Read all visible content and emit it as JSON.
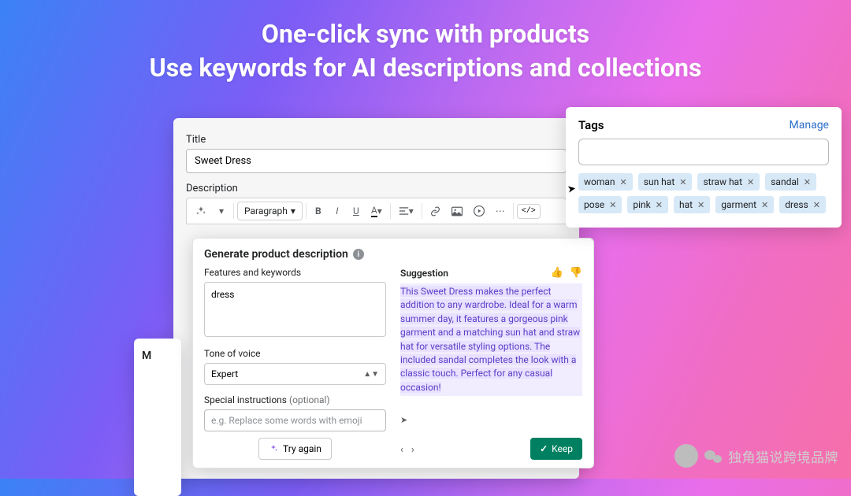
{
  "headline": {
    "line1": "One-click sync with products",
    "line2": "Use keywords for AI descriptions and collections"
  },
  "editor": {
    "title_label": "Title",
    "title_value": "Sweet Dress",
    "desc_label": "Description",
    "para_label": "Paragraph"
  },
  "popover": {
    "heading": "Generate product description",
    "features_label": "Features and keywords",
    "features_value": "dress",
    "tone_label": "Tone of voice",
    "tone_value": "Expert",
    "special_label": "Special instructions",
    "special_optional": "(optional)",
    "special_placeholder": "e.g. Replace some words with emoji",
    "try_again": "Try again",
    "suggestion_label": "Suggestion",
    "suggestion_text": "This Sweet Dress makes the perfect addition to any wardrobe. Ideal for a warm summer day, it features a gorgeous pink garment and a matching sun hat and straw hat for versatile styling options. The included sandal completes the look with a classic touch. Perfect for any casual occasion!",
    "keep": "Keep"
  },
  "tags_panel": {
    "title": "Tags",
    "manage": "Manage",
    "tags": [
      "woman",
      "sun hat",
      "straw hat",
      "sandal",
      "pose",
      "pink",
      "hat",
      "garment",
      "dress"
    ]
  },
  "fragment": {
    "m": "M"
  },
  "watermark": "独角猫说跨境品牌"
}
